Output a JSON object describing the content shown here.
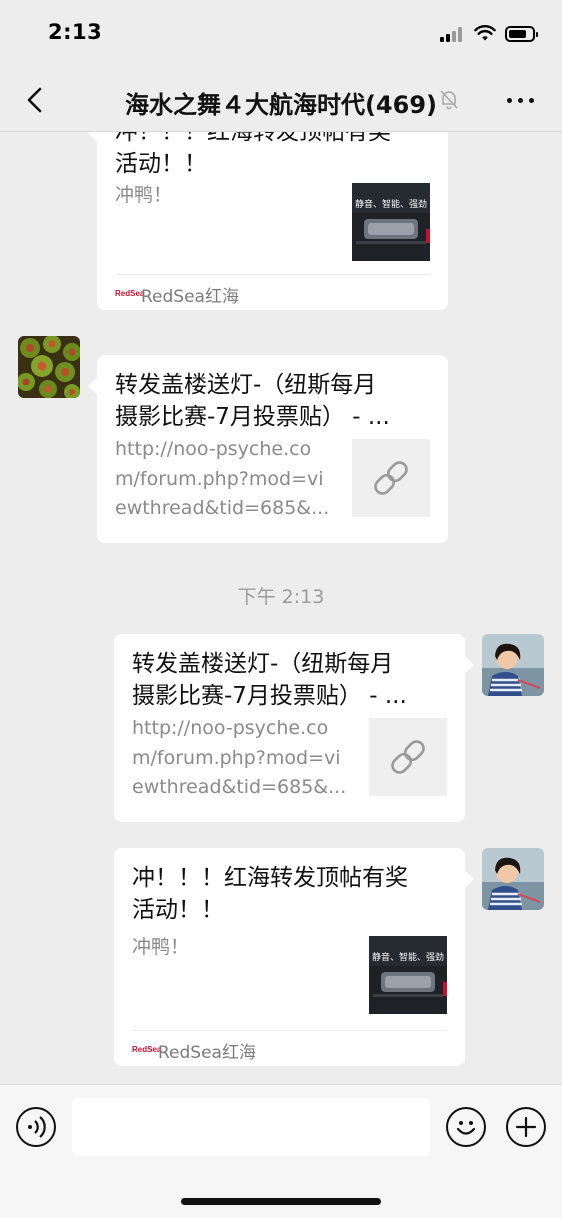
{
  "status_bar": {
    "time": "2:13"
  },
  "nav": {
    "title": "海水之舞４大航海时代(469)",
    "back_icon": "chevron-left-icon",
    "mute_icon": "bell-off-icon",
    "more_icon": "more-dots-icon"
  },
  "messages": [
    {
      "type": "article",
      "side": "left",
      "title_lines": [
        "冲！！！红海转发顶帖有奖",
        "活动！！"
      ],
      "desc": "冲鸭！",
      "thumb_text": "静音、智能、强劲",
      "source_logo": "RedSea",
      "source": "RedSea红海",
      "partially_hidden": true
    },
    {
      "type": "link",
      "side": "left",
      "title_lines": [
        "转发盖楼送灯-（纽斯每月",
        "摄影比赛-7月投票贴） - ..."
      ],
      "url_lines": [
        "http://noo-psyche.co",
        "m/forum.php?mod=vi",
        "ewthread&tid=685&..."
      ],
      "thumb_icon": "link-icon"
    },
    {
      "type": "timestamp",
      "text": "下午 2:13"
    },
    {
      "type": "link",
      "side": "right",
      "title_lines": [
        "转发盖楼送灯-（纽斯每月",
        "摄影比赛-7月投票贴） - ..."
      ],
      "url_lines": [
        "http://noo-psyche.co",
        "m/forum.php?mod=vi",
        "ewthread&tid=685&..."
      ],
      "thumb_icon": "link-icon"
    },
    {
      "type": "article",
      "side": "right",
      "title_lines": [
        "冲！！！红海转发顶帖有奖",
        "活动！！"
      ],
      "desc": "冲鸭！",
      "thumb_text": "静音、智能、强劲",
      "source_logo": "RedSea",
      "source": "RedSea红海"
    }
  ],
  "input_bar": {
    "voice_icon": "voice-icon",
    "emoji_icon": "emoji-icon",
    "plus_icon": "plus-icon",
    "placeholder": ""
  },
  "colors": {
    "background": "#ededed",
    "card": "#ffffff",
    "muted_text": "#8a8a8a",
    "brand_red": "#c8102e"
  }
}
